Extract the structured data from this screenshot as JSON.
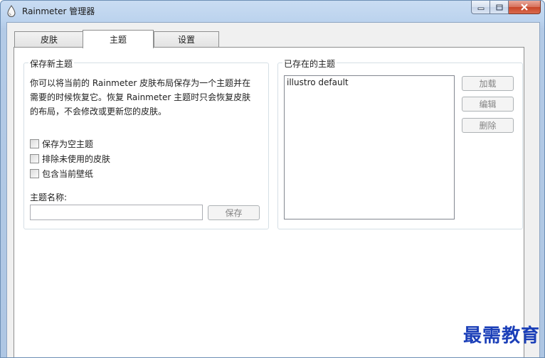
{
  "window": {
    "title": "Rainmeter 管理器"
  },
  "tabs": [
    {
      "label": "皮肤"
    },
    {
      "label": "主题"
    },
    {
      "label": "设置"
    }
  ],
  "save_theme": {
    "legend": "保存新主题",
    "description_line1": "你可以将当前的 Rainmeter 皮肤布局保存为一个主题并在",
    "description_line2": "需要的时候恢复它。恢复 Rainmeter 主题时只会恢复皮肤",
    "description_line3": "的布局，不会修改或更新您的皮肤。",
    "options": [
      {
        "label": "保存为空主题",
        "checked": false
      },
      {
        "label": "排除未使用的皮肤",
        "checked": false
      },
      {
        "label": "包含当前壁纸",
        "checked": false
      }
    ],
    "name_label": "主题名称:",
    "name_value": "",
    "save_button": "保存"
  },
  "existing_themes": {
    "legend": "已存在的主题",
    "items": [
      "illustro default"
    ],
    "load_button": "加载",
    "edit_button": "编辑",
    "delete_button": "删除"
  },
  "watermark": "最需教育",
  "colors": {
    "titlebar": "#bcd3ee",
    "panel_bg": "#ffffff",
    "disabled_text": "#838383",
    "watermark": "#1b3fb8"
  }
}
